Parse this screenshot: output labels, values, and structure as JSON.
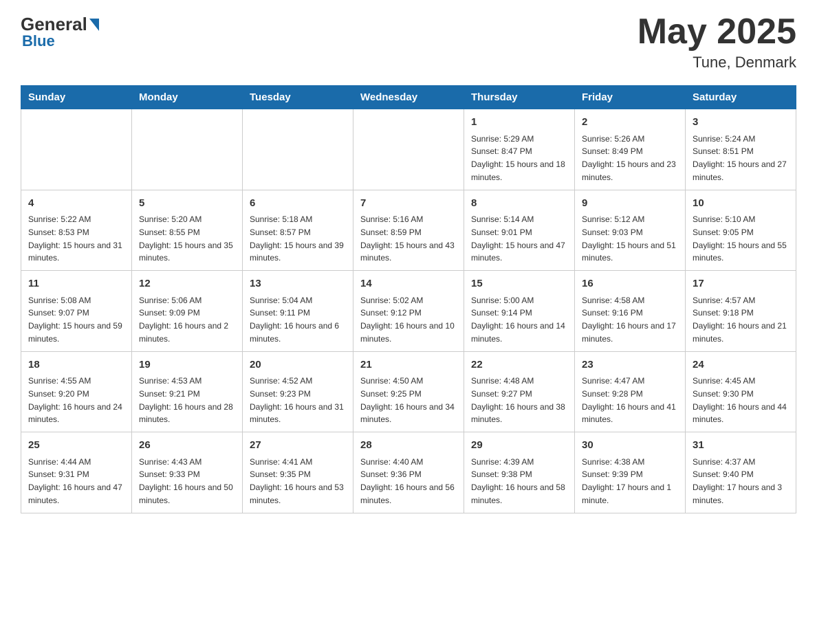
{
  "header": {
    "logo": {
      "general": "General",
      "blue": "Blue"
    },
    "title": "May 2025",
    "location": "Tune, Denmark"
  },
  "weekdays": [
    "Sunday",
    "Monday",
    "Tuesday",
    "Wednesday",
    "Thursday",
    "Friday",
    "Saturday"
  ],
  "weeks": [
    [
      {
        "day": "",
        "info": ""
      },
      {
        "day": "",
        "info": ""
      },
      {
        "day": "",
        "info": ""
      },
      {
        "day": "",
        "info": ""
      },
      {
        "day": "1",
        "info": "Sunrise: 5:29 AM\nSunset: 8:47 PM\nDaylight: 15 hours and 18 minutes."
      },
      {
        "day": "2",
        "info": "Sunrise: 5:26 AM\nSunset: 8:49 PM\nDaylight: 15 hours and 23 minutes."
      },
      {
        "day": "3",
        "info": "Sunrise: 5:24 AM\nSunset: 8:51 PM\nDaylight: 15 hours and 27 minutes."
      }
    ],
    [
      {
        "day": "4",
        "info": "Sunrise: 5:22 AM\nSunset: 8:53 PM\nDaylight: 15 hours and 31 minutes."
      },
      {
        "day": "5",
        "info": "Sunrise: 5:20 AM\nSunset: 8:55 PM\nDaylight: 15 hours and 35 minutes."
      },
      {
        "day": "6",
        "info": "Sunrise: 5:18 AM\nSunset: 8:57 PM\nDaylight: 15 hours and 39 minutes."
      },
      {
        "day": "7",
        "info": "Sunrise: 5:16 AM\nSunset: 8:59 PM\nDaylight: 15 hours and 43 minutes."
      },
      {
        "day": "8",
        "info": "Sunrise: 5:14 AM\nSunset: 9:01 PM\nDaylight: 15 hours and 47 minutes."
      },
      {
        "day": "9",
        "info": "Sunrise: 5:12 AM\nSunset: 9:03 PM\nDaylight: 15 hours and 51 minutes."
      },
      {
        "day": "10",
        "info": "Sunrise: 5:10 AM\nSunset: 9:05 PM\nDaylight: 15 hours and 55 minutes."
      }
    ],
    [
      {
        "day": "11",
        "info": "Sunrise: 5:08 AM\nSunset: 9:07 PM\nDaylight: 15 hours and 59 minutes."
      },
      {
        "day": "12",
        "info": "Sunrise: 5:06 AM\nSunset: 9:09 PM\nDaylight: 16 hours and 2 minutes."
      },
      {
        "day": "13",
        "info": "Sunrise: 5:04 AM\nSunset: 9:11 PM\nDaylight: 16 hours and 6 minutes."
      },
      {
        "day": "14",
        "info": "Sunrise: 5:02 AM\nSunset: 9:12 PM\nDaylight: 16 hours and 10 minutes."
      },
      {
        "day": "15",
        "info": "Sunrise: 5:00 AM\nSunset: 9:14 PM\nDaylight: 16 hours and 14 minutes."
      },
      {
        "day": "16",
        "info": "Sunrise: 4:58 AM\nSunset: 9:16 PM\nDaylight: 16 hours and 17 minutes."
      },
      {
        "day": "17",
        "info": "Sunrise: 4:57 AM\nSunset: 9:18 PM\nDaylight: 16 hours and 21 minutes."
      }
    ],
    [
      {
        "day": "18",
        "info": "Sunrise: 4:55 AM\nSunset: 9:20 PM\nDaylight: 16 hours and 24 minutes."
      },
      {
        "day": "19",
        "info": "Sunrise: 4:53 AM\nSunset: 9:21 PM\nDaylight: 16 hours and 28 minutes."
      },
      {
        "day": "20",
        "info": "Sunrise: 4:52 AM\nSunset: 9:23 PM\nDaylight: 16 hours and 31 minutes."
      },
      {
        "day": "21",
        "info": "Sunrise: 4:50 AM\nSunset: 9:25 PM\nDaylight: 16 hours and 34 minutes."
      },
      {
        "day": "22",
        "info": "Sunrise: 4:48 AM\nSunset: 9:27 PM\nDaylight: 16 hours and 38 minutes."
      },
      {
        "day": "23",
        "info": "Sunrise: 4:47 AM\nSunset: 9:28 PM\nDaylight: 16 hours and 41 minutes."
      },
      {
        "day": "24",
        "info": "Sunrise: 4:45 AM\nSunset: 9:30 PM\nDaylight: 16 hours and 44 minutes."
      }
    ],
    [
      {
        "day": "25",
        "info": "Sunrise: 4:44 AM\nSunset: 9:31 PM\nDaylight: 16 hours and 47 minutes."
      },
      {
        "day": "26",
        "info": "Sunrise: 4:43 AM\nSunset: 9:33 PM\nDaylight: 16 hours and 50 minutes."
      },
      {
        "day": "27",
        "info": "Sunrise: 4:41 AM\nSunset: 9:35 PM\nDaylight: 16 hours and 53 minutes."
      },
      {
        "day": "28",
        "info": "Sunrise: 4:40 AM\nSunset: 9:36 PM\nDaylight: 16 hours and 56 minutes."
      },
      {
        "day": "29",
        "info": "Sunrise: 4:39 AM\nSunset: 9:38 PM\nDaylight: 16 hours and 58 minutes."
      },
      {
        "day": "30",
        "info": "Sunrise: 4:38 AM\nSunset: 9:39 PM\nDaylight: 17 hours and 1 minute."
      },
      {
        "day": "31",
        "info": "Sunrise: 4:37 AM\nSunset: 9:40 PM\nDaylight: 17 hours and 3 minutes."
      }
    ]
  ]
}
